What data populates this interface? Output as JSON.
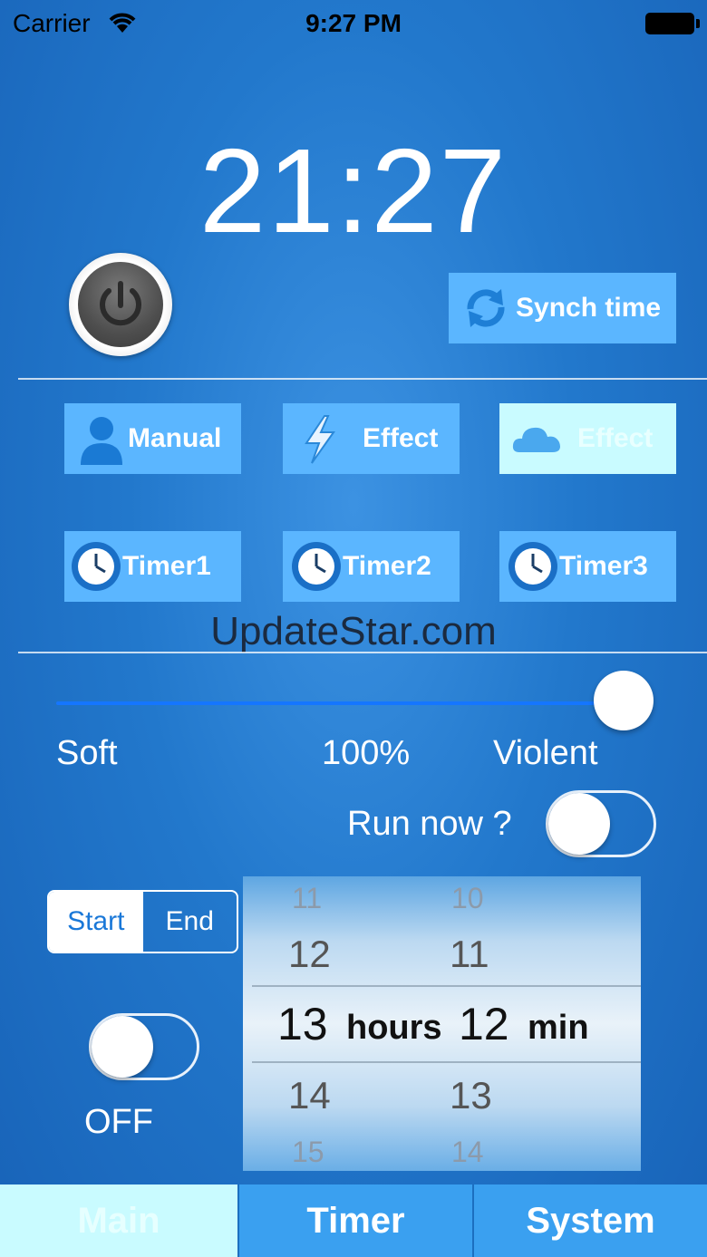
{
  "status_bar": {
    "carrier": "Carrier",
    "time": "9:27 PM"
  },
  "clock": "21:27",
  "sync_button": {
    "label": "Synch time",
    "icon": "sync-icon"
  },
  "modes": [
    {
      "label": "Manual",
      "icon": "person-icon",
      "selected": false
    },
    {
      "label": "Effect",
      "icon": "lightning-icon",
      "selected": false
    },
    {
      "label": "Effect",
      "icon": "cloud-icon",
      "selected": true
    }
  ],
  "timers": [
    {
      "label": "Timer1",
      "icon": "clock-icon"
    },
    {
      "label": "Timer2",
      "icon": "clock-icon"
    },
    {
      "label": "Timer3",
      "icon": "clock-icon"
    }
  ],
  "watermark": "UpdateStar.com",
  "intensity": {
    "min_label": "Soft",
    "value_label": "100%",
    "max_label": "Violent",
    "value": 1.0
  },
  "run_now": {
    "label": "Run now ?",
    "on": false
  },
  "segment": {
    "start": "Start",
    "end": "End",
    "selected": "Start"
  },
  "enable_switch": {
    "label": "OFF",
    "on": false
  },
  "picker": {
    "hours": [
      "11",
      "12",
      "13",
      "14",
      "15"
    ],
    "minutes": [
      "10",
      "11",
      "12",
      "13",
      "14"
    ],
    "hours_unit": "hours",
    "minutes_unit": "min",
    "selected_hour": "13",
    "selected_min": "12"
  },
  "tabs": [
    {
      "label": "Main",
      "selected": true
    },
    {
      "label": "Timer",
      "selected": false
    },
    {
      "label": "System",
      "selected": false
    }
  ],
  "colors": {
    "button": "#5bb6ff",
    "selected": "#c9fbff",
    "slider_fill": "#1576ff"
  }
}
